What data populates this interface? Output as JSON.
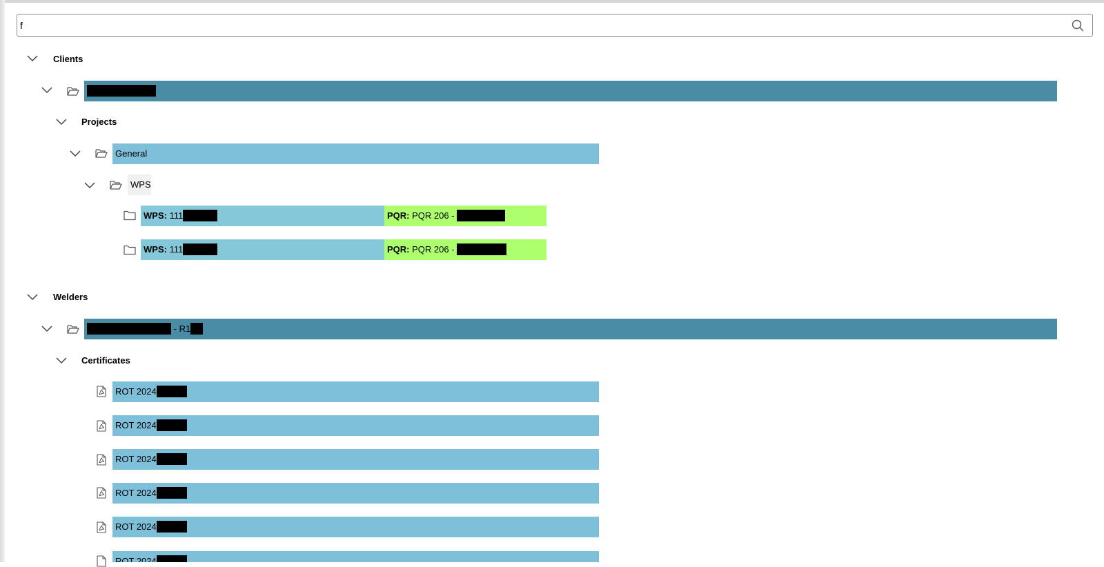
{
  "search": {
    "value": "f",
    "placeholder": ""
  },
  "tree": {
    "clients": {
      "label": "Clients",
      "client_name_suffix": "",
      "projects_label": "Projects",
      "project_general": "General",
      "wps_folder": "WPS",
      "wps_items": [
        {
          "wps_label": "WPS:",
          "wps_value": "111",
          "pqr_label": "PQR:",
          "pqr_value": "PQR 206 -"
        },
        {
          "wps_label": "WPS:",
          "wps_value": "111",
          "pqr_label": "PQR:",
          "pqr_value": "PQR 206 -"
        }
      ]
    },
    "welders": {
      "label": "Welders",
      "welder_suffix": "- R1",
      "certificates_label": "Certificates",
      "certificates": [
        {
          "label": "ROT 2024"
        },
        {
          "label": "ROT 2024"
        },
        {
          "label": "ROT 2024"
        },
        {
          "label": "ROT 2024"
        },
        {
          "label": "ROT 2024"
        },
        {
          "label": "ROT 2024"
        }
      ]
    }
  },
  "colors": {
    "row_dark": "#4a8ba6",
    "row_light": "#7ebfd9",
    "row_pqr": "#adff6e"
  }
}
